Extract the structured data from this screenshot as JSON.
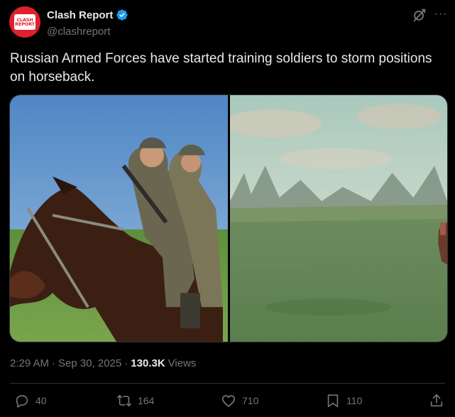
{
  "author": {
    "display_name": "Clash Report",
    "handle": "@clashreport",
    "avatar_text_line1": "CLASH",
    "avatar_text_line2": "REPORT",
    "verified": true
  },
  "tweet": {
    "text": "Russian Armed Forces have started training soldiers to storm positions on horseback."
  },
  "meta": {
    "time": "2:29 AM",
    "dot1": "·",
    "date": "Sep 30, 2025",
    "dot2": "·",
    "views_count": "130.3K",
    "views_label": "Views"
  },
  "actions": {
    "replies": "40",
    "reposts": "164",
    "likes": "710",
    "bookmarks": "110"
  },
  "colors": {
    "background": "#000000",
    "text": "#e7e9ea",
    "muted": "#71767b",
    "verified": "#1d9bf0",
    "brand": "#e0202a",
    "border": "#2f3336"
  },
  "icons": {
    "verified": "verified-badge-icon",
    "grok": "grok-icon",
    "more": "more-icon",
    "reply": "reply-icon",
    "repost": "repost-icon",
    "like": "heart-icon",
    "bookmark": "bookmark-icon",
    "share": "share-icon"
  }
}
